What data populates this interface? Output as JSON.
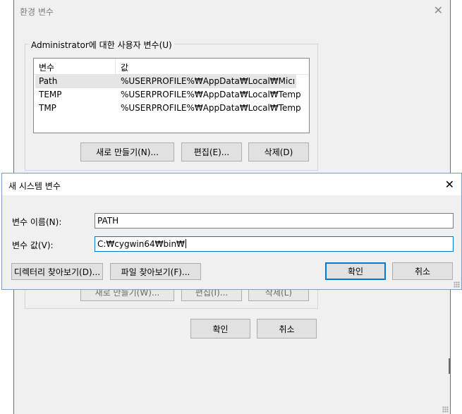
{
  "env_window": {
    "title": "환경 변수",
    "close_glyph": "✕",
    "user_group": {
      "legend": "Administrator에 대한 사용자 변수(U)",
      "columns": [
        "변수",
        "값"
      ],
      "rows": [
        {
          "name": "Path",
          "value": "%USERPROFILE%₩AppData₩Local₩Micros..."
        },
        {
          "name": "TEMP",
          "value": "%USERPROFILE%₩AppData₩Local₩Temp"
        },
        {
          "name": "TMP",
          "value": "%USERPROFILE%₩AppData₩Local₩Temp"
        }
      ],
      "buttons": {
        "new": "새로 만들기(N)...",
        "edit": "편집(E)...",
        "delete": "삭제(D)"
      }
    },
    "system_group": {
      "partial_buttons": {
        "new": "새로 만들기(W)...",
        "edit": "편집(I)...",
        "delete": "삭제(L)"
      }
    },
    "ok": "확인",
    "cancel": "취소"
  },
  "new_system_var_dialog": {
    "title": "새 시스템 변수",
    "close_glyph": "✕",
    "name_label": "변수 이름(N):",
    "name_value": "PATH",
    "value_label": "변수 값(V):",
    "value_value": "C:₩cygwin64₩bin₩",
    "browse_dir": "디렉터리 찾아보기(D)...",
    "browse_file": "파일 찾아보기(F)...",
    "ok": "확인",
    "cancel": "취소"
  }
}
